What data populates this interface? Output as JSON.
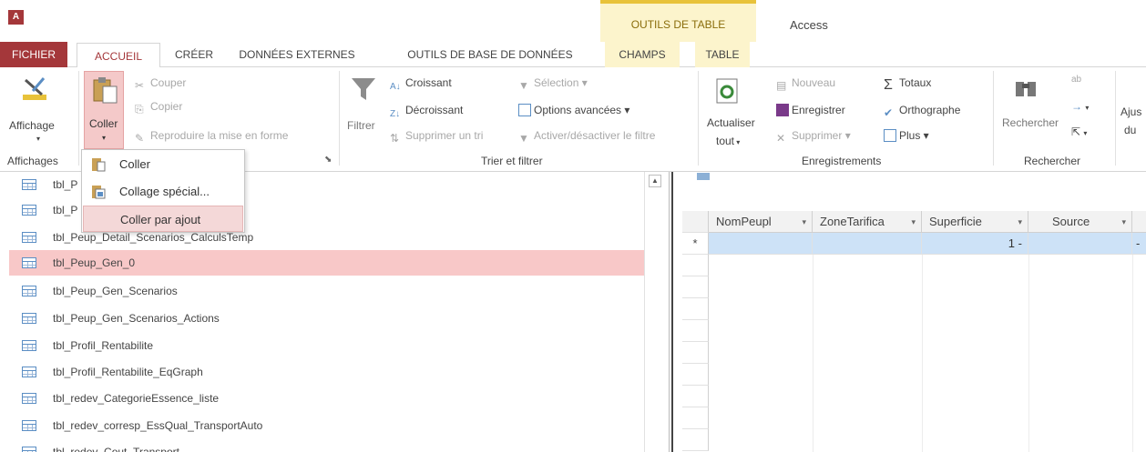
{
  "titlebar": {
    "app_icon_text": "A",
    "context_group": "OUTILS DE TABLE",
    "window_title": "Access"
  },
  "tabs": {
    "fichier": "FICHIER",
    "accueil": "ACCUEIL",
    "creer": "CRÉER",
    "donnees": "DONNÉES EXTERNES",
    "outils": "OUTILS DE BASE DE DONNÉES",
    "champs": "CHAMPS",
    "table": "TABLE"
  },
  "ribbon": {
    "affichage": "Affichage",
    "affichages_group": "Affichages",
    "coller": "Coller",
    "couper": "Couper",
    "copier": "Copier",
    "reproduire": "Reproduire la mise en forme",
    "filtrer": "Filtrer",
    "croissant": "Croissant",
    "decroissant": "Décroissant",
    "supprimer_tri": "Supprimer un tri",
    "selection": "Sélection",
    "options_avancees": "Options avancées",
    "activer_filtre": "Activer/désactiver le filtre",
    "trier_group": "Trier et filtrer",
    "actualiser_1": "Actualiser",
    "actualiser_2": "tout",
    "nouveau": "Nouveau",
    "enregistrer": "Enregistrer",
    "supprimer": "Supprimer",
    "totaux": "Totaux",
    "orthographe": "Orthographe",
    "plus": "Plus",
    "enregistrements_group": "Enregistrements",
    "rechercher": "Rechercher",
    "rechercher_group": "Rechercher",
    "ajust_1": "Ajus",
    "ajust_2": "du"
  },
  "paste_menu": {
    "coller": "Coller",
    "collage_special": "Collage spécial...",
    "coller_ajout": "Coller par ajout"
  },
  "objects": [
    "tbl_P",
    "tbl_P",
    "tbl_Peup_Detail_Scenarios_CalculsTemp",
    "tbl_Peup_Gen_0",
    "tbl_Peup_Gen_Scenarios",
    "tbl_Peup_Gen_Scenarios_Actions",
    "tbl_Profil_Rentabilite",
    "tbl_Profil_Rentabilite_EqGraph",
    "tbl_redev_CategorieEssence_liste",
    "tbl_redev_corresp_EssQual_TransportAuto",
    "tbl_redev_Cout_Transport"
  ],
  "datasheet": {
    "columns": [
      "NomPeupl",
      "ZoneTarifica",
      "Superficie",
      "Source"
    ],
    "new_row_marker": "*",
    "new_row_values": [
      "",
      "",
      "1",
      "-"
    ],
    "extra_dash": "-"
  },
  "colors": {
    "accent": "#a4373a",
    "context": "#fcf4cc",
    "selection": "#f8c8c8",
    "new_row": "#cde2f7"
  }
}
